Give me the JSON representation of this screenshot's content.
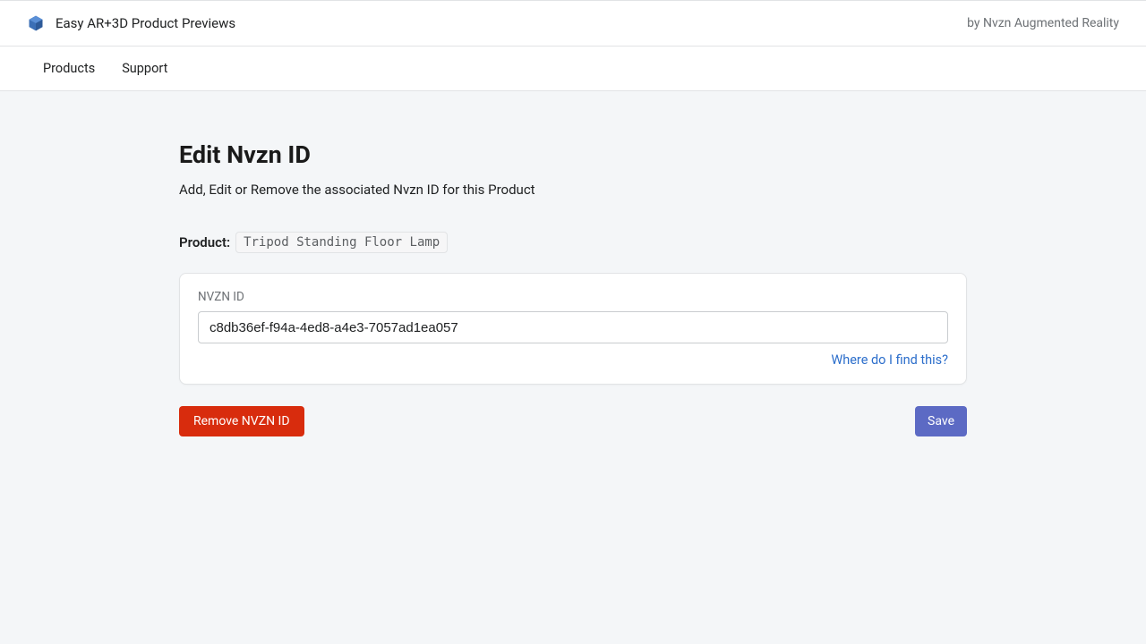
{
  "header": {
    "app_title": "Easy AR+3D Product Previews",
    "author_prefix": "by ",
    "author": "Nvzn Augmented Reality"
  },
  "nav": {
    "products": "Products",
    "support": "Support"
  },
  "page": {
    "title": "Edit Nvzn ID",
    "subtitle": "Add, Edit or Remove the associated Nvzn ID for this Product",
    "product_label": "Product:",
    "product_name": "Tripod Standing Floor Lamp"
  },
  "form": {
    "field_label": "NVZN ID",
    "field_value": "c8db36ef-f94a-4ed8-a4e3-7057ad1ea057",
    "help_link": "Where do I find this?"
  },
  "buttons": {
    "remove": "Remove NVZN ID",
    "save": "Save"
  }
}
